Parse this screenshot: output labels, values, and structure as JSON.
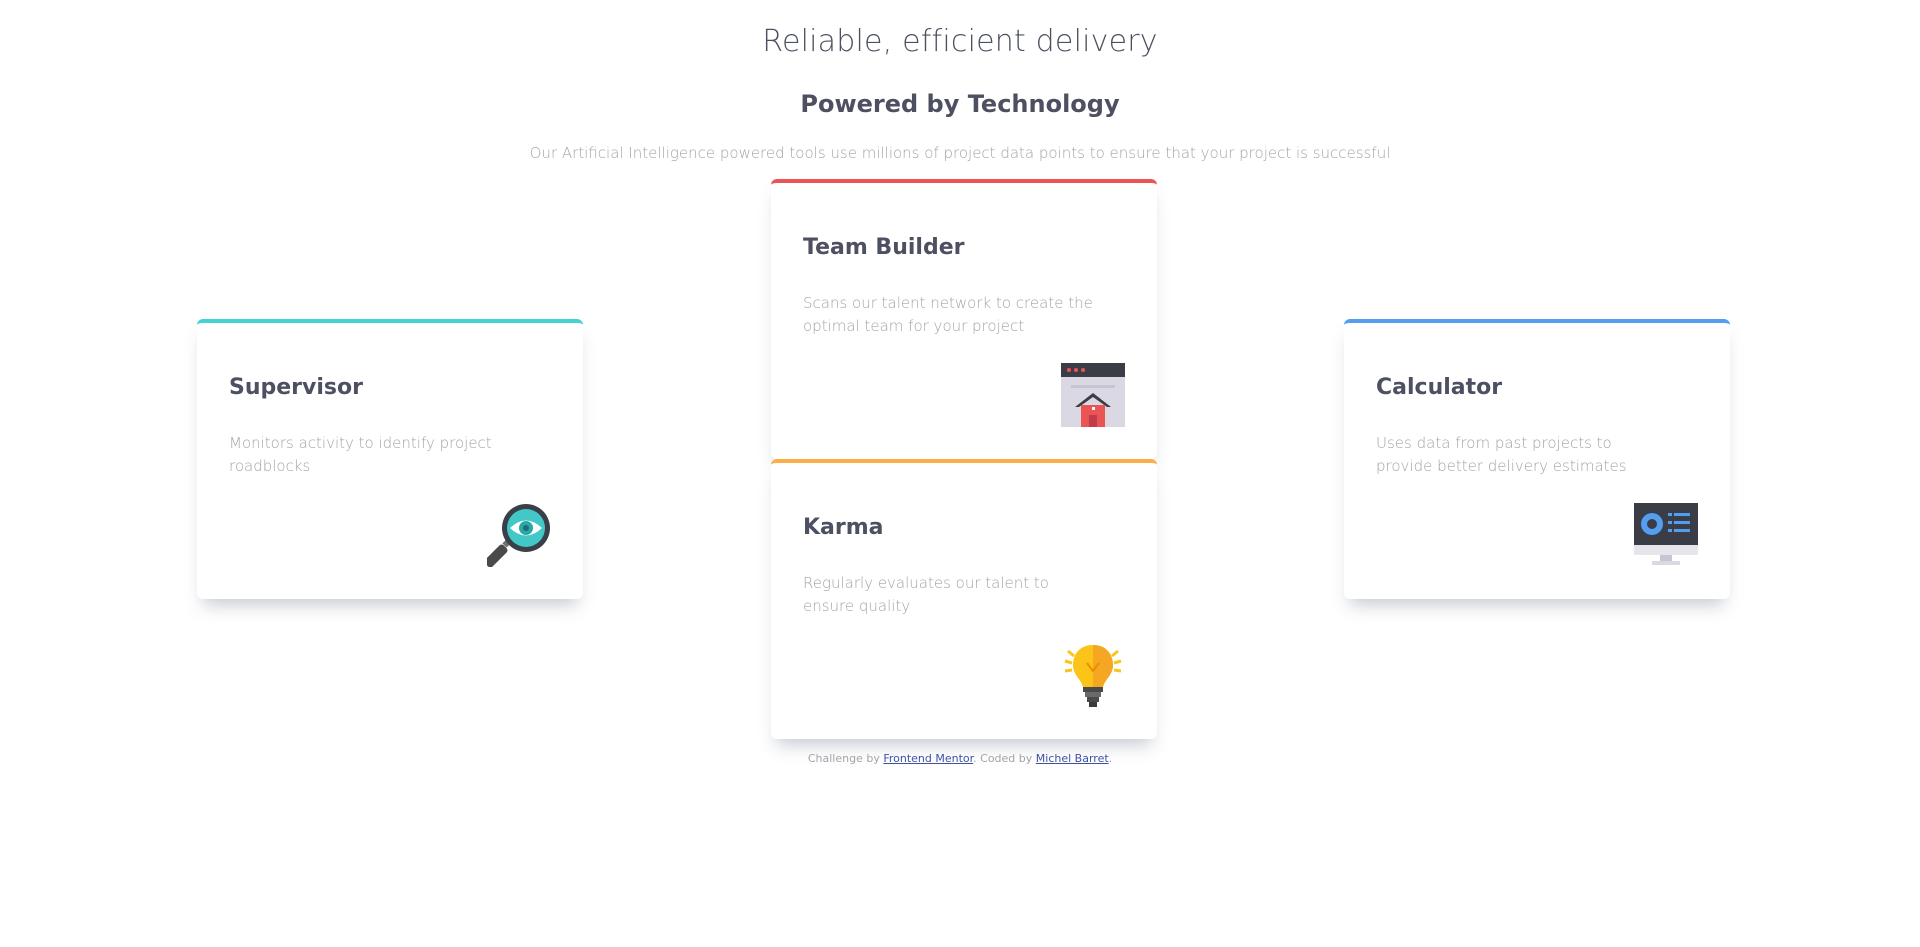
{
  "header": {
    "title_light": "Reliable, efficient delivery",
    "title_bold": "Powered by Technology",
    "subtitle": "Our Artificial Intelligence powered tools use millions of project data points to ensure that your project is successful"
  },
  "cards": {
    "supervisor": {
      "title": "Supervisor",
      "text": "Monitors activity to identify project roadblocks",
      "icon": "magnifier-eye-icon",
      "accent": "#44d3d2"
    },
    "team_builder": {
      "title": "Team Builder",
      "text": "Scans our talent network to create the optimal team for your project",
      "icon": "browser-house-icon",
      "accent": "#ea5454"
    },
    "karma": {
      "title": "Karma",
      "text": "Regularly evaluates our talent to ensure quality",
      "icon": "lightbulb-icon",
      "accent": "#fcae4a"
    },
    "calculator": {
      "title": "Calculator",
      "text": "Uses data from past projects to provide better delivery estimates",
      "icon": "monitor-chart-icon",
      "accent": "#549ef2"
    }
  },
  "footer": {
    "prefix": "Challenge by ",
    "link1": "Frontend Mentor",
    "middle": ". Coded by ",
    "link2": "Michel Barret",
    "suffix": "."
  }
}
